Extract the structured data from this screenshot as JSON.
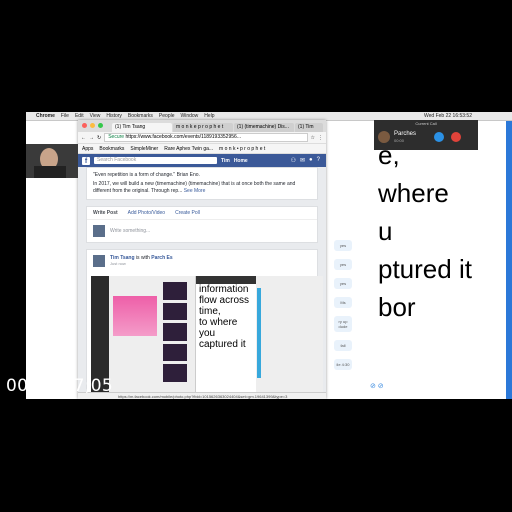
{
  "macos": {
    "apple": "",
    "menu": [
      "Chrome",
      "File",
      "Edit",
      "View",
      "History",
      "Bookmarks",
      "People",
      "Window",
      "Help"
    ],
    "clock": "Wed Feb 22  16:53:52"
  },
  "browser": {
    "tabs": [
      "(1) Tim Tsang",
      "m o n k e p r o p h e t",
      "(1) (timemachine) Dis...",
      "(1) Tim"
    ],
    "secure_label": "Secure",
    "url": "https://www.facebook.com/events/1189193352956...",
    "bookmarks": [
      "Apps",
      "Bookmarks",
      "SimpleMiner",
      "Rare Aphex Twin ga...",
      "m o n k • p r o p h e t"
    ],
    "status_url": "https://m.facebook.com/mobile/photo.php?fbid=1015626363024404&set=gm.19641399&type=3"
  },
  "facebook": {
    "logo": "f",
    "search_placeholder": "Search Facebook",
    "user": "Tim",
    "home": "Home",
    "post1_line1": "\"Even repetition is a form of change.\" Brian Eno.",
    "post1_line2": "In 2017, we will build a new (timemachine) (timemachine) that is at once both the same and different from the original. Through rep...",
    "see_more": "See More",
    "composer_write": "Write Post",
    "composer_photo": "Add Photo/Video",
    "composer_poll": "Create Poll",
    "composer_placeholder": "Write something...",
    "post2_author": "Tim Tsang",
    "post2_with": "is with",
    "post2_tagged": "Parch Es",
    "post2_time": "Just now",
    "screenshot_text": "information\nflow across\ntime,\nto where\nyou\ncaptured it"
  },
  "slide_text": "e,\nwhere\nu\nptured it\nbor",
  "messages": [
    "yes",
    "yes",
    "yes",
    "Ms",
    "ry up dude",
    "fall",
    "ile 4:30"
  ],
  "call": {
    "header": "Current Call",
    "name": "Parches",
    "status": "00:00"
  },
  "timecode": "00:01:27;05"
}
